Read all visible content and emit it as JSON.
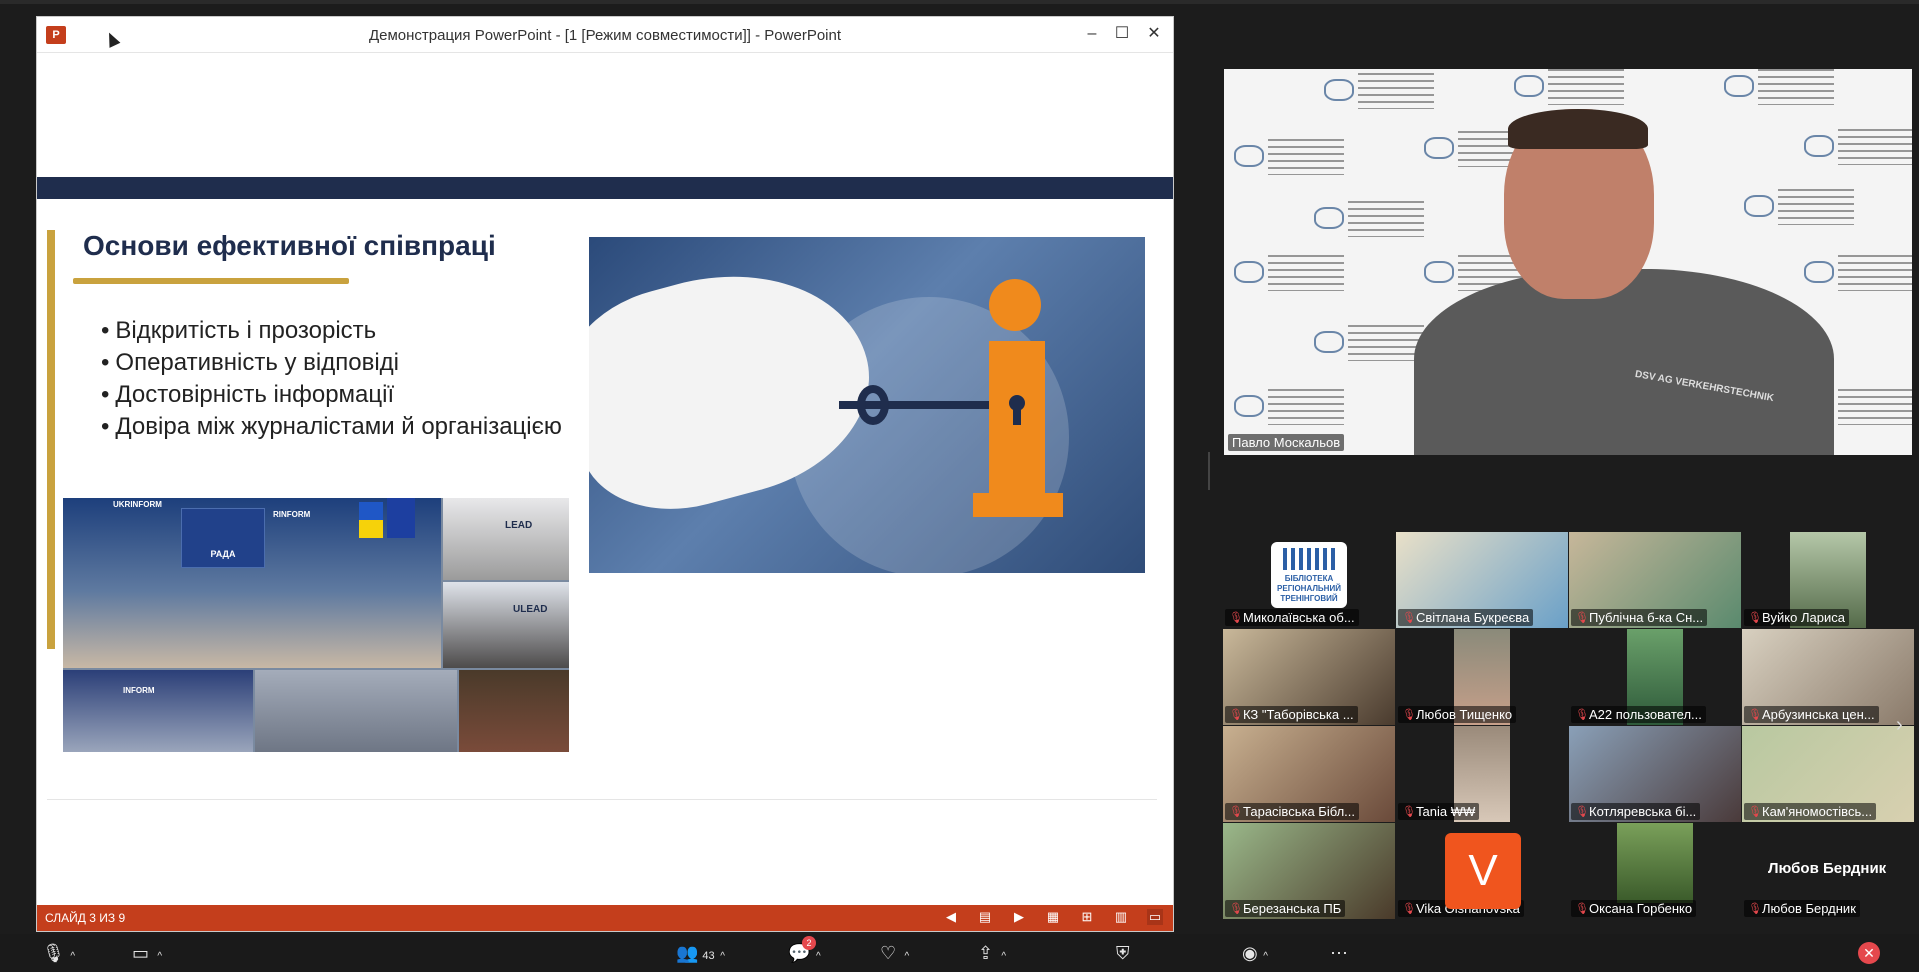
{
  "ppt": {
    "window_title": "Демонстрация PowerPoint - [1 [Режим совместимости]] - PowerPoint",
    "logo_letter": "P",
    "slide_counter": "СЛАЙД 3 ИЗ 9",
    "slide": {
      "title": "Основи ефективної співпраці",
      "bullets": [
        "Відкритість і прозорість",
        "Оперативність у відповіді",
        "Достовірність інформації",
        "Довіра між журналістами й організацією"
      ],
      "collage_labels": {
        "rada": "РАДА",
        "lead": "LEAD",
        "lead2": "ULEAD",
        "ukrinform": "UKRINFORM",
        "inform": "INFORM",
        "rinform": "RINFORM"
      }
    }
  },
  "speaker": {
    "name": "Павло Москальов",
    "shirt_logo": "DSV AG VERKEHRSTECHNIK"
  },
  "participants": [
    {
      "name": "Миколаївська об..."
    },
    {
      "name": "Світлана Букреєва"
    },
    {
      "name": "Публічна б-ка Сн..."
    },
    {
      "name": "Вуйко Лариса"
    },
    {
      "name": "КЗ \"Таборівська ..."
    },
    {
      "name": "Любов Тищенко"
    },
    {
      "name": "A22 пользовател..."
    },
    {
      "name": "Арбузинська цен..."
    },
    {
      "name": "Тарасівська Бібл..."
    },
    {
      "name": "Tania ₩₩"
    },
    {
      "name": "Котляревська бі..."
    },
    {
      "name": "Кам'яномостівсь..."
    },
    {
      "name": "Березанська ПБ"
    },
    {
      "name": "Vika Olshanovska"
    },
    {
      "name": "Оксана Горбенко"
    },
    {
      "name": "Любов Бердник"
    }
  ],
  "big_name": "Любов Бердник",
  "avatar_letter": "V",
  "library_logo_text": "БІБЛІОТЕКА РЕГІОНАЛЬНИЙ ТРЕНІНГОВИЙ",
  "toolbar": {
    "participants_count": "43",
    "chat_badge": "2"
  },
  "colors": {
    "ppt_accent": "#c43e1c",
    "slide_navy": "#1f2d4d",
    "slide_gold": "#c9a23e",
    "info_orange": "#f08a1c",
    "mic_off": "#e5484d"
  }
}
